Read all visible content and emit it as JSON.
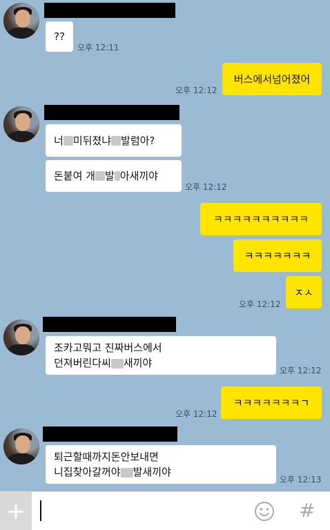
{
  "chat": {
    "m1": {
      "text": "??",
      "time": "오후 12:11"
    },
    "m2": {
      "text": "버스에서넘어졌어",
      "time": "오후 12:12"
    },
    "m3": {
      "a": "너",
      "b": "미뒤졌냐 ",
      "c": "발럼아?"
    },
    "m4": {
      "a": "돈붙여 개",
      "b": "발",
      "c": "아새끼야",
      "time": "오후 12:12"
    },
    "m5": {
      "text": "ㅋㅋㅋㅋㅋㅋㅋㅋㅋㅋ"
    },
    "m6": {
      "text": "ㅋㅋㅋㅋㅋㅋㅋ"
    },
    "m7": {
      "text": "ㅈㅅ",
      "time": "오후 12:12"
    },
    "m8": {
      "line1": "조카고뭐고 진짜버스에서",
      "line2a": "던져버린다씨",
      "line2b": "새끼야",
      "time": "오후 12:12"
    },
    "m9": {
      "text": "ㅋㅋㅋㅋㅋㅋㅋㄱ",
      "time": "오후 12:12"
    },
    "m10": {
      "line1": "퇴근할때까지돈안보내면",
      "line2a": "니집찾아갈꺼야",
      "line2b": "발새끼야",
      "time": "오후 12:13"
    }
  },
  "icons": {
    "plus": "plus-icon",
    "emoji": "emoji-icon",
    "hash": "hash-icon"
  },
  "colors": {
    "background": "#9bbbd4",
    "outgoing": "#fee500",
    "incoming": "#ffffff"
  }
}
